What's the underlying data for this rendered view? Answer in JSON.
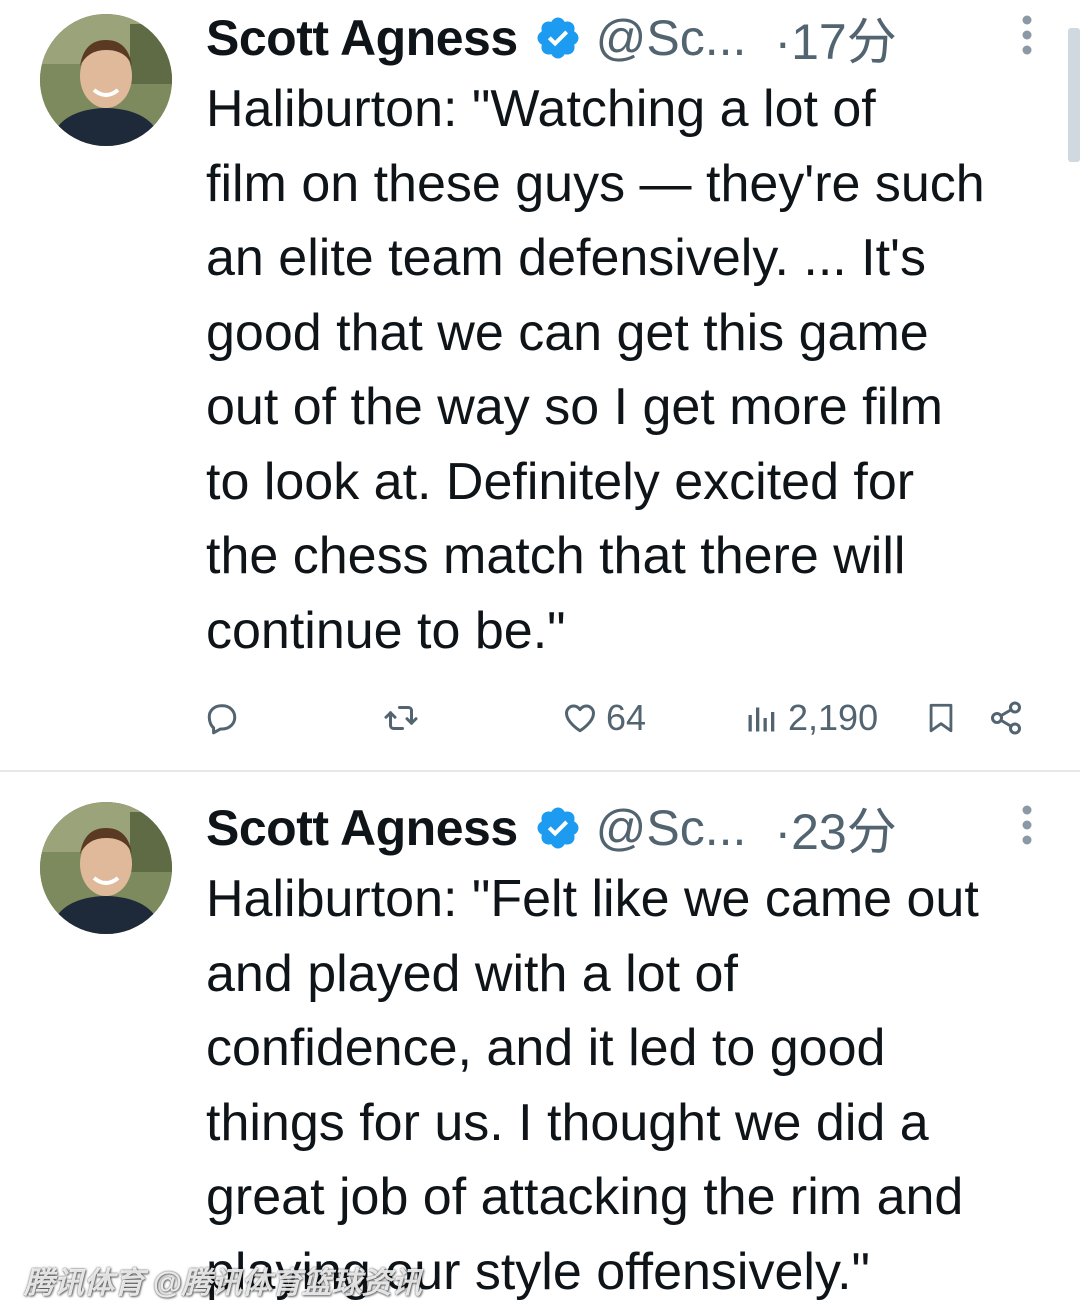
{
  "tweets": [
    {
      "author_name": "Scott Agness",
      "handle": "@Sc...",
      "time": "·17分",
      "lines": [
        "Haliburton: \"Watching a lot of",
        "film on these guys — they're such",
        "an elite team defensively. ... It's",
        "good that we can get this game",
        "out of the way so I get more film",
        "to look at. Definitely excited for",
        "the chess match that there will",
        "continue to be.\""
      ],
      "likes": "64",
      "views": "2,190"
    },
    {
      "author_name": "Scott Agness",
      "handle": "@Sc...",
      "time": "·23分",
      "lines": [
        "Haliburton: \"Felt like we came out",
        "and played with a lot of",
        "confidence, and it led to good",
        "things for us. I thought we did a",
        "great job of attacking the rim and",
        "playing our style offensively.\""
      ]
    }
  ],
  "watermark": "腾讯体育 @腾讯体育篮球资讯",
  "icons": {
    "verified": "verified-badge-icon",
    "more": "more-vertical-icon",
    "reply": "reply-icon",
    "retweet": "retweet-icon",
    "like": "heart-icon",
    "views": "views-chart-icon",
    "bookmark": "bookmark-icon",
    "share": "share-icon"
  },
  "colors": {
    "verified": "#1d9bf0",
    "secondary_text": "#536471",
    "primary_text": "#0f1419"
  }
}
